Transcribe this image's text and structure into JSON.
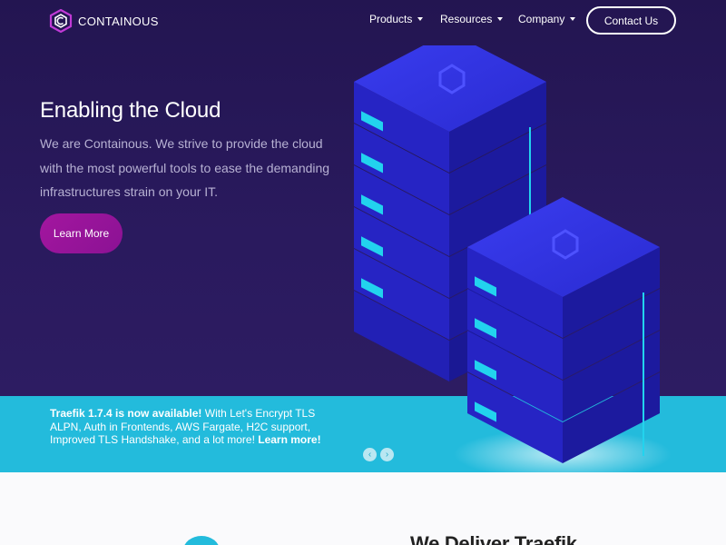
{
  "brand": {
    "name": "CONTAINOUS",
    "logo_icon": "containous-logo-icon"
  },
  "nav": {
    "items": [
      {
        "label": "Products"
      },
      {
        "label": "Resources"
      },
      {
        "label": "Company"
      }
    ],
    "contact_label": "Contact Us"
  },
  "hero": {
    "title": "Enabling the Cloud",
    "text": "We are Containous. We strive to provide the cloud with the most powerful tools to ease the demanding infrastructures strain on your IT.",
    "button_label": "Learn More",
    "illustration_icon": "server-stack-illustration"
  },
  "announcement": {
    "bold_text": "Traefik 1.7.4 is now available!",
    "text": " With Let's Encrypt TLS ALPN, Auth in Frontends, AWS Fargate, H2C support, Improved TLS Handshake, and a lot more! ",
    "link_label": "Learn more!",
    "prev_icon": "chevron-left-icon",
    "next_icon": "chevron-right-icon"
  },
  "section": {
    "title": "We Deliver Traefik"
  },
  "colors": {
    "hero_bg": "#231551",
    "accent_cyan": "#23bbdc",
    "button_magenta": "#a3169f",
    "server_blue": "#2a2bd1"
  }
}
